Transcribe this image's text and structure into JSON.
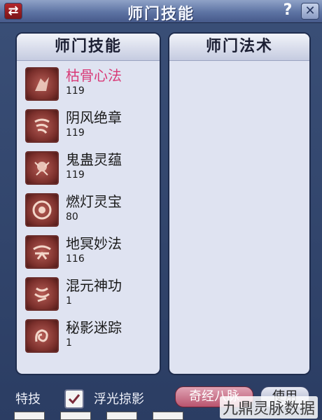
{
  "window": {
    "title": "师门技能",
    "help_label": "?"
  },
  "left_panel": {
    "header": "师门技能",
    "skills": [
      {
        "name": "枯骨心法",
        "level": "119",
        "icon": "skull-heart-icon",
        "active": true
      },
      {
        "name": "阴风绝章",
        "level": "119",
        "icon": "wind-scroll-icon",
        "active": false
      },
      {
        "name": "鬼蛊灵蕴",
        "level": "119",
        "icon": "ghost-gu-icon",
        "active": false
      },
      {
        "name": "燃灯灵宝",
        "level": "80",
        "icon": "lamp-treasure-icon",
        "active": false
      },
      {
        "name": "地冥妙法",
        "level": "116",
        "icon": "underworld-icon",
        "active": false
      },
      {
        "name": "混元神功",
        "level": "1",
        "icon": "chaos-origin-icon",
        "active": false
      },
      {
        "name": "秘影迷踪",
        "level": "1",
        "icon": "shadow-trace-icon",
        "active": false
      }
    ]
  },
  "right_panel": {
    "header": "师门法术"
  },
  "bottom": {
    "special_label": "特技",
    "checkbox_label": "浮光掠影",
    "checkbox_checked": true,
    "qijing_button": "奇经八脉",
    "use_button": "使用"
  },
  "watermark": "九鼎灵脉数据",
  "colors": {
    "active_skill": "#d83a77",
    "panel_bg": "#dfe3f1",
    "window_bg": "#2b3d63"
  }
}
